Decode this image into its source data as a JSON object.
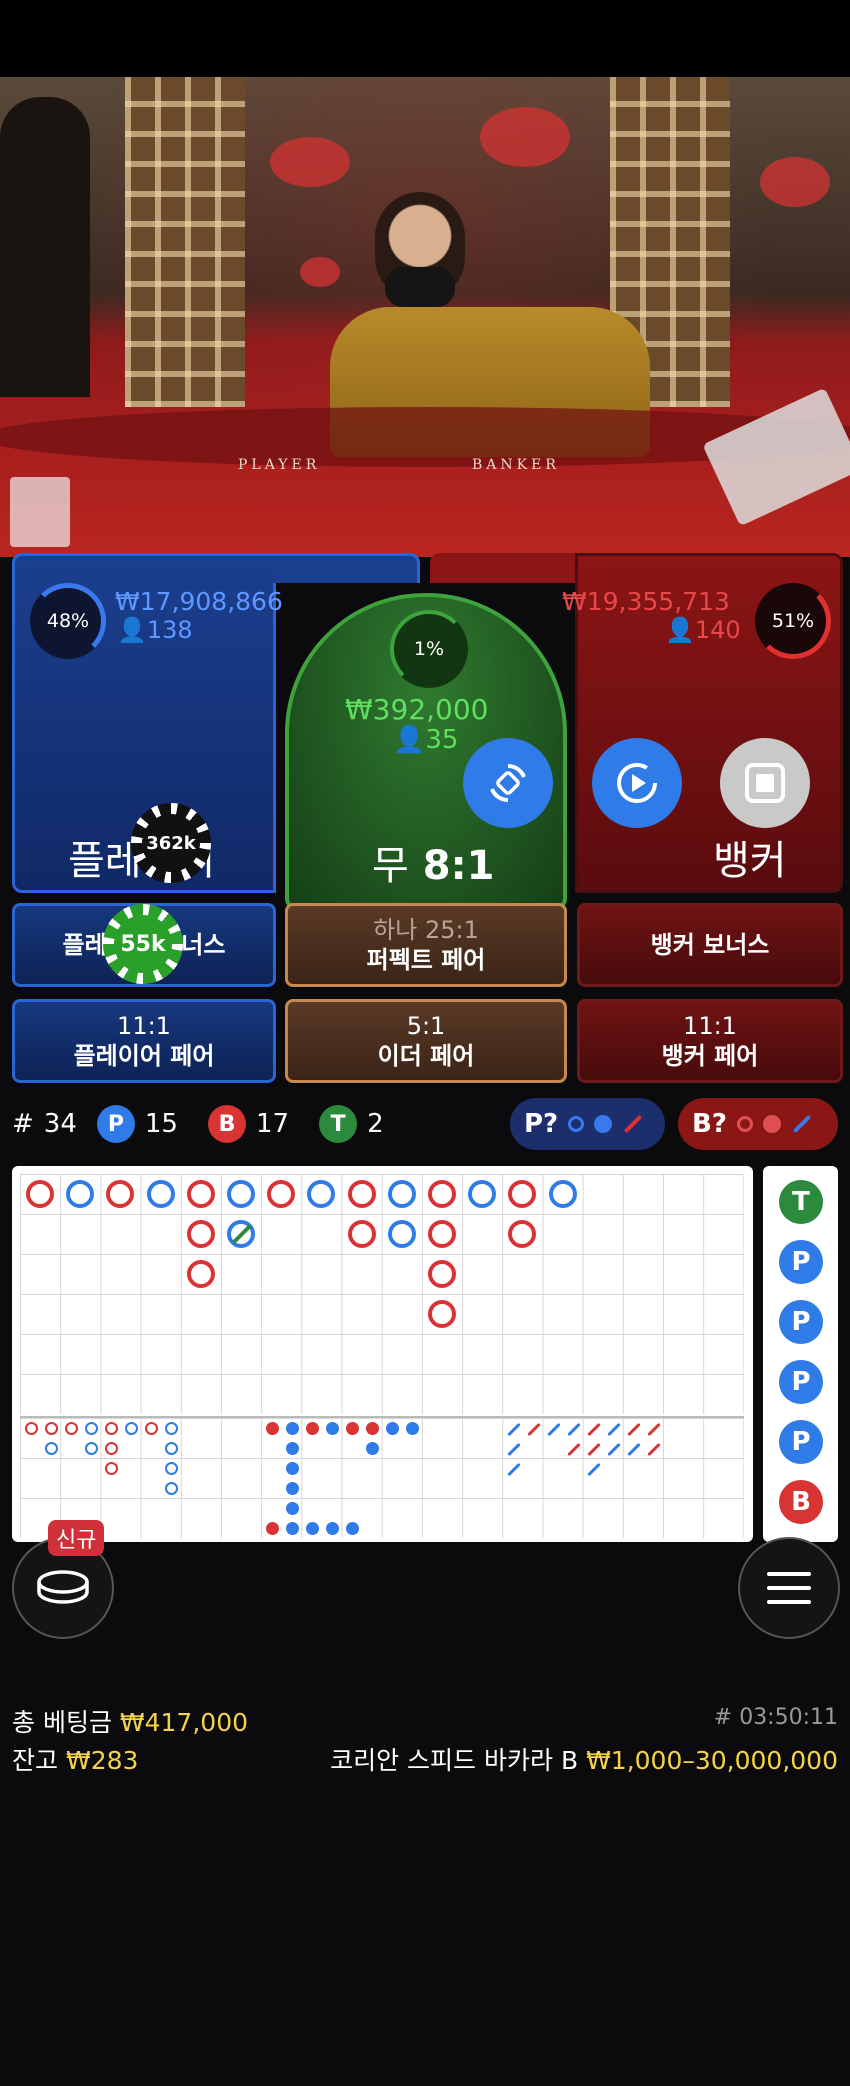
{
  "table_labels": {
    "player": "PLAYER",
    "banker": "BANKER"
  },
  "player": {
    "percent": "48%",
    "amount": "₩17,908,866",
    "count": "138",
    "label": "플레이어",
    "chip": "362k"
  },
  "banker": {
    "percent": "51%",
    "amount": "₩19,355,713",
    "count": "140",
    "label": "뱅커"
  },
  "tie": {
    "percent": "1%",
    "amount": "₩392,000",
    "count": "35",
    "label_prefix": "무",
    "label_odds": "8:1"
  },
  "controls": {
    "rebet_icon": "rebet-icon",
    "replay_icon": "replay-icon",
    "stop_icon": "stop-icon"
  },
  "side_bets": {
    "player_bonus": "플레이어 보너스",
    "player_bonus_chip": "55k",
    "perfect_pair_odds": "하나 25:1",
    "perfect_pair": "퍼펙트 페어",
    "banker_bonus": "뱅커 보너스",
    "player_pair_odds": "11:1",
    "player_pair": "플레이어 페어",
    "either_pair_odds": "5:1",
    "either_pair": "이더 페어",
    "banker_pair_odds": "11:1",
    "banker_pair": "뱅커 페어"
  },
  "stats": {
    "hash": "#",
    "round": "34",
    "p_label": "P",
    "p_count": "15",
    "b_label": "B",
    "b_count": "17",
    "t_label": "T",
    "t_count": "2",
    "predict_p": "P?",
    "predict_b": "B?"
  },
  "bead_road": [
    "T",
    "P",
    "P",
    "P",
    "P",
    "B"
  ],
  "bottom": {
    "new_badge": "신규",
    "total_bet_label": "총 베팅금",
    "total_bet_value": "₩417,000",
    "balance_label": "잔고",
    "balance_value": "₩283",
    "game_id": "# 03:50:11",
    "table_name": "코리안 스피드 바카라 B",
    "limits": "₩1,000–30,000,000"
  },
  "colors": {
    "player": "#2f7be8",
    "banker": "#d93434",
    "tie": "#2c8a3c",
    "gold": "#f3d34a"
  }
}
